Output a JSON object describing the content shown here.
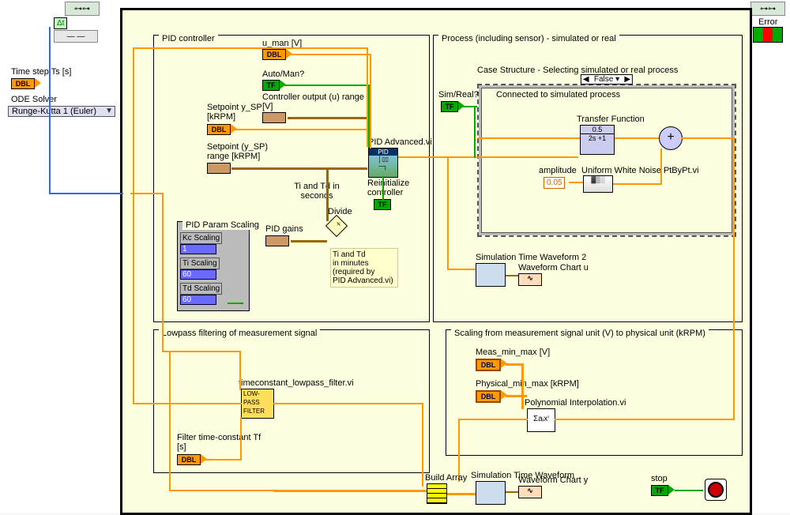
{
  "left": {
    "ts_label": "Time step Ts [s]",
    "ode_label": "ODE Solver",
    "ode_value": "Runge-Kutta 1 (Euler)",
    "dt_symbol": "Δt"
  },
  "top_right": {
    "error_label": "Error"
  },
  "pid": {
    "title": "PID controller",
    "setpoint_label": "Setpoint y_SP [kRPM]",
    "setpoint_range_label": "Setpoint (y_SP) range [kRPM]",
    "param_scaling_title": "PID Param Scaling",
    "kc_label": "Kc Scaling",
    "kc_value": "1",
    "ti_label": "Ti Scaling",
    "ti_value": "60",
    "td_label": "Td Scaling",
    "td_value": "60",
    "gains_label": "PID gains",
    "u_man_label": "u_man [V]",
    "auto_man_label": "Auto/Man?",
    "ctrl_out_label": "Controller output (u) range [V]",
    "pid_vi": "PID Advanced.vi",
    "reinit_label": "Reinitialize controller",
    "divide_label": "Divide",
    "ti_seconds_label": "Ti and Td in seconds",
    "minutes_note_l1": "Ti and Td",
    "minutes_note_l2": "in minutes",
    "minutes_note_l3": "(required by",
    "minutes_note_l4": "PID Advanced.vi)"
  },
  "process": {
    "title": "Process (including sensor) - simulated or real",
    "case_title": "Case Structure - Selecting simulated or real process",
    "case_value": "False",
    "inner_title": "Connected to simulated process",
    "sim_real_label": "Sim/Real?",
    "tf_label": "Transfer Function",
    "tf_num": "0.5",
    "tf_den": "2s +1",
    "amp_label": "amplitude",
    "amp_value": "0.05",
    "noise_vi": "Uniform White Noise PtByPt.vi",
    "waveform2_label": "Simulation Time Waveform 2",
    "chart_u_label": "Waveform Chart u"
  },
  "lowpass": {
    "title": "Lowpass filtering of measurement signal",
    "vi_label": "timeconstant_lowpass_filter.vi",
    "icon_l1": "LOW-",
    "icon_l2": "PASS",
    "icon_l3": "FILTER",
    "tf_label": "Filter time-constant Tf [s]"
  },
  "scaling": {
    "title": "Scaling from measurement signal unit (V) to physical unit (kRPM)",
    "meas_label": "Meas_min_max [V]",
    "phys_label": "Physical_min_max [kRPM]",
    "poly_vi": "Polynomial Interpolation.vi",
    "poly_icon": "Σaᵢxⁱ"
  },
  "bottom": {
    "build_array": "Build Array",
    "waveform_label": "Simulation Time Waveform",
    "chart_y_label": "Waveform Chart y",
    "stop_label": "stop"
  },
  "tokens": {
    "dbl": "DBL",
    "tf": "TF",
    "pid": "PID"
  }
}
